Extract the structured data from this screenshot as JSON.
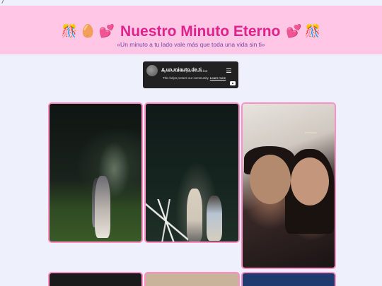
{
  "page": {
    "corner_mark": "/",
    "colors": {
      "background": "#eef0fb",
      "header_background": "#ffc6e6",
      "title": "#e0228a",
      "subtitle": "#7345a8",
      "photo_border": "#ff8ec4"
    }
  },
  "header": {
    "emoji_left_1": "🎊",
    "emoji_left_2": "🥚",
    "emoji_left_3": "💕",
    "title": "Nuestro Minuto Eterno",
    "emoji_right_1": "💕",
    "emoji_right_2": "🎊",
    "subtitle": "«Un minuto a tu lado vale más que toda una vida sin ti»"
  },
  "video": {
    "title": "A un minuto de ti",
    "notice": "Sign in to confirm you're not a bot",
    "help_text": "This helps protect our community.",
    "learn_more": "Learn more",
    "menu_icon": "playlist-icon",
    "brand_icon": "youtube-icon"
  },
  "gallery": {
    "photos": [
      {
        "alt": "photo-1"
      },
      {
        "alt": "photo-2"
      },
      {
        "alt": "photo-3",
        "watermark": "Kinestudi"
      },
      {
        "alt": "photo-4"
      },
      {
        "alt": "photo-5"
      },
      {
        "alt": "photo-6"
      }
    ]
  }
}
